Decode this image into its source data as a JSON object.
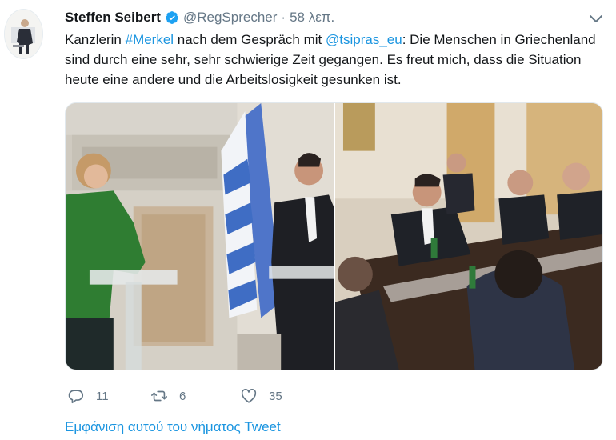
{
  "author": {
    "display_name": "Steffen Seibert",
    "handle": "@RegSprecher",
    "separator": "·",
    "time": "58 λεπ."
  },
  "tweet": {
    "segments": [
      {
        "type": "text",
        "value": "Kanzlerin "
      },
      {
        "type": "link",
        "value": "#Merkel"
      },
      {
        "type": "text",
        "value": " nach dem Gespräch mit "
      },
      {
        "type": "link",
        "value": "@tsipras_eu"
      },
      {
        "type": "text",
        "value": ": Die Menschen in Griechenland sind durch eine sehr, sehr schwierige Zeit gegangen. Es freut mich, dass die Situation heute eine andere und die Arbeitslosigkeit gesunken ist."
      }
    ]
  },
  "actions": {
    "replies": "11",
    "retweets": "6",
    "likes": "35"
  },
  "show_thread_label": "Εμφάνιση αυτού του νήματος Tweet",
  "icons": {
    "verified": "verified-badge-icon",
    "caret": "chevron-down-icon",
    "reply": "reply-icon",
    "retweet": "retweet-icon",
    "like": "heart-icon"
  },
  "colors": {
    "link": "#1b95e0",
    "secondary_text": "#657786",
    "verified": "#1da1f2"
  }
}
